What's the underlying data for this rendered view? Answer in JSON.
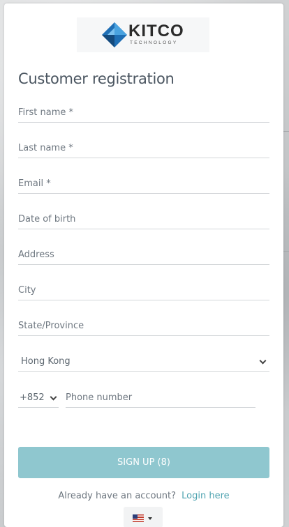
{
  "brand": {
    "logo_text": "KITCO",
    "logo_subtext": "TECHNOLOGY"
  },
  "form": {
    "title": "Customer registration",
    "first_name_placeholder": "First name *",
    "last_name_placeholder": "Last name *",
    "email_placeholder": "Email *",
    "dob_placeholder": "Date of birth",
    "address_placeholder": "Address",
    "city_placeholder": "City",
    "state_placeholder": "State/Province",
    "country_value": "Hong Kong",
    "phone_code_value": "+852",
    "phone_placeholder": "Phone number",
    "signup_label": "SIGN UP (8)",
    "login_prompt": "Already have an account?",
    "login_link": "Login here"
  },
  "language": {
    "flag_icon": "us-flag-icon"
  },
  "colors": {
    "accent": "#8fc7cf",
    "link": "#4ea3b0"
  }
}
